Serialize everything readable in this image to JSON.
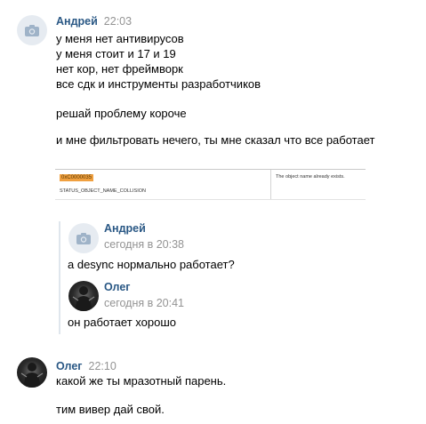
{
  "messages": [
    {
      "author": "Андрей",
      "time": "22:03",
      "lines": [
        "у меня нет антивирусов",
        "у меня стоит и 17 и 19",
        "нет кор, нет фреймворк",
        "все сдк и инструменты разработчиков"
      ],
      "line2": "решай проблему короче",
      "line3": "и мне фильтровать нечего, ты мне сказал что все работает",
      "attachment": {
        "code": "0xC0000035",
        "name": "STATUS_OBJECT_NAME_COLLISION",
        "desc": "The object name already exists."
      }
    },
    {
      "forwarded": [
        {
          "author": "Андрей",
          "date": "сегодня в 20:38",
          "text": "a desync нормально работает?"
        },
        {
          "author": "Олег",
          "date": "сегодня в 20:41",
          "text": "он работает хорошо"
        }
      ]
    },
    {
      "author": "Олег",
      "time": "22:10",
      "line1": "какой же ты мразотный парень.",
      "line2": "тим вивер дай свой."
    }
  ]
}
